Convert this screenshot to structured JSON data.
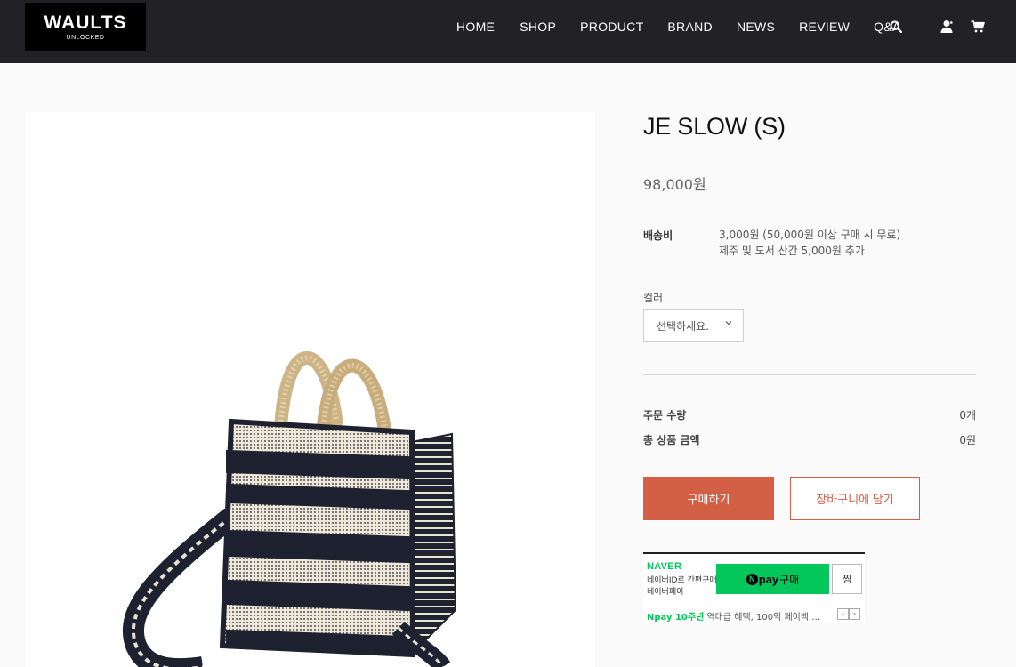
{
  "header": {
    "logo_main": "WAULTS",
    "logo_sub": "UNLOCKED",
    "nav": [
      "HOME",
      "SHOP",
      "PRODUCT",
      "BRAND",
      "NEWS",
      "REVIEW",
      "Q&A"
    ],
    "icons": [
      "search-icon",
      "user-icon",
      "cart-icon"
    ]
  },
  "product": {
    "title": "JE SLOW (S)",
    "price": "98,000원",
    "shipping_label": "배송비",
    "shipping_line1": "3,000원 (50,000원 이상 구매 시 무료)",
    "shipping_line2": "제주 및 도서 산간 5,000원 추가",
    "color_label": "컬러",
    "color_select": "선택하세요.",
    "qty_label": "주문 수량",
    "qty_value": "0개",
    "total_label": "총 상품 금액",
    "total_value": "0원",
    "buy_label": "구매하기",
    "cart_label": "장바구니에 담기"
  },
  "npay": {
    "brand": "NAVER",
    "desc1": "네이버ID로 간편구매",
    "desc2": "네이버페이",
    "pay_n": "N",
    "pay_word": "pay",
    "pay_action": "구매",
    "wish_label": "찜",
    "promo_highlight": "Npay 10주년",
    "promo_text": "역대급 혜택, 100억 페이백 …",
    "prev": "‹",
    "next": "›"
  },
  "colors": {
    "header_bg": "#212126",
    "accent": "#d35f45",
    "naver_green": "#03c75a"
  }
}
